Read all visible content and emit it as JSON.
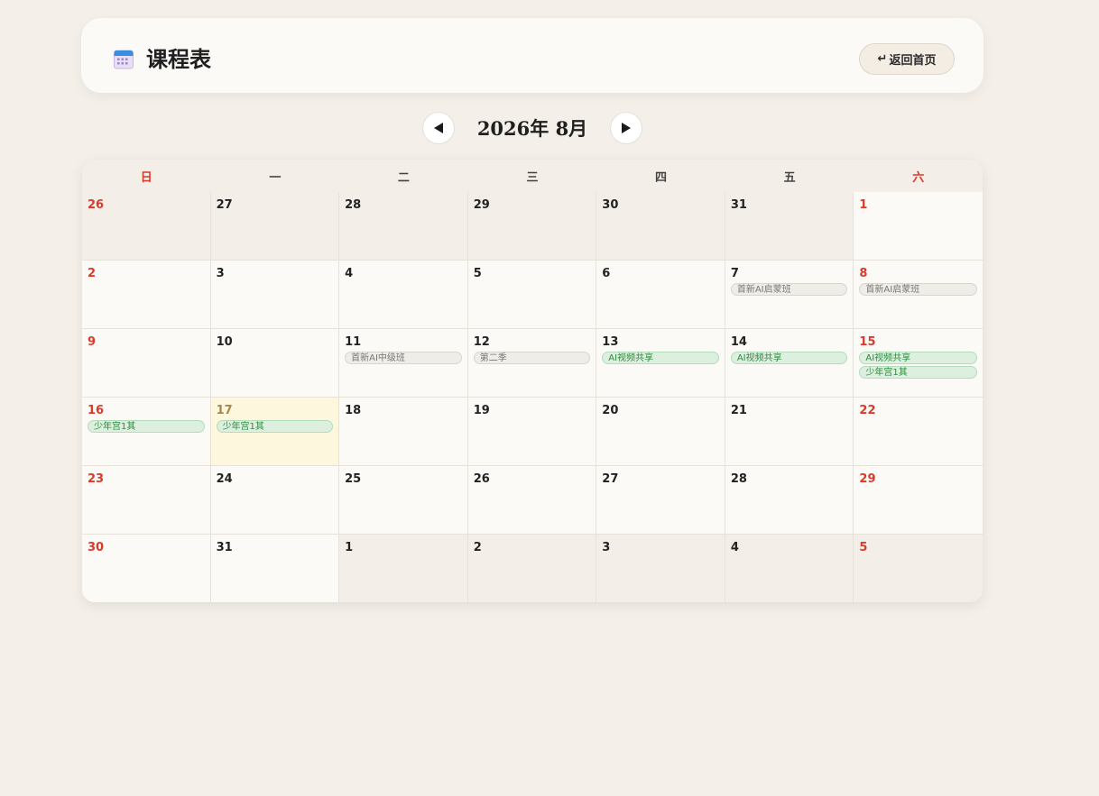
{
  "header": {
    "title": "课程表",
    "home_button": "返回首页",
    "icon": "calendar-icon"
  },
  "nav": {
    "month_label": "2026年 8月",
    "prev_icon": "triangle-left-icon",
    "next_icon": "triangle-right-icon"
  },
  "weekdays": [
    "日",
    "一",
    "二",
    "三",
    "四",
    "五",
    "六"
  ],
  "colors": {
    "weekend": "#d93b2b",
    "today_bg": "#fdf8dd",
    "event_green": "#ddefdf",
    "event_grey": "#eeede8"
  },
  "days": [
    {
      "num": "26",
      "other": true,
      "events": []
    },
    {
      "num": "27",
      "other": true,
      "events": []
    },
    {
      "num": "28",
      "other": true,
      "events": []
    },
    {
      "num": "29",
      "other": true,
      "events": []
    },
    {
      "num": "30",
      "other": true,
      "events": []
    },
    {
      "num": "31",
      "other": true,
      "events": []
    },
    {
      "num": "1",
      "other": false,
      "events": []
    },
    {
      "num": "2",
      "other": false,
      "events": []
    },
    {
      "num": "3",
      "other": false,
      "events": []
    },
    {
      "num": "4",
      "other": false,
      "events": []
    },
    {
      "num": "5",
      "other": false,
      "events": []
    },
    {
      "num": "6",
      "other": false,
      "events": []
    },
    {
      "num": "7",
      "other": false,
      "events": [
        {
          "label": "首新AI启蒙班",
          "style": "grey"
        }
      ]
    },
    {
      "num": "8",
      "other": false,
      "events": [
        {
          "label": "首新AI启蒙班",
          "style": "grey"
        }
      ]
    },
    {
      "num": "9",
      "other": false,
      "events": []
    },
    {
      "num": "10",
      "other": false,
      "events": []
    },
    {
      "num": "11",
      "other": false,
      "events": [
        {
          "label": "首新AI中级班",
          "style": "grey"
        }
      ]
    },
    {
      "num": "12",
      "other": false,
      "events": [
        {
          "label": "第二季",
          "style": "grey"
        }
      ]
    },
    {
      "num": "13",
      "other": false,
      "events": [
        {
          "label": "AI视频共享",
          "style": "green"
        }
      ]
    },
    {
      "num": "14",
      "other": false,
      "events": [
        {
          "label": "AI视频共享",
          "style": "green"
        }
      ]
    },
    {
      "num": "15",
      "other": false,
      "events": [
        {
          "label": "AI视频共享",
          "style": "green"
        },
        {
          "label": "少年宫1其",
          "style": "green"
        }
      ]
    },
    {
      "num": "16",
      "other": false,
      "events": [
        {
          "label": "少年宫1其",
          "style": "green"
        }
      ]
    },
    {
      "num": "17",
      "other": false,
      "today": true,
      "events": [
        {
          "label": "少年宫1其",
          "style": "green"
        }
      ]
    },
    {
      "num": "18",
      "other": false,
      "events": []
    },
    {
      "num": "19",
      "other": false,
      "events": []
    },
    {
      "num": "20",
      "other": false,
      "events": []
    },
    {
      "num": "21",
      "other": false,
      "events": []
    },
    {
      "num": "22",
      "other": false,
      "events": []
    },
    {
      "num": "23",
      "other": false,
      "events": []
    },
    {
      "num": "24",
      "other": false,
      "events": []
    },
    {
      "num": "25",
      "other": false,
      "events": []
    },
    {
      "num": "26",
      "other": false,
      "events": []
    },
    {
      "num": "27",
      "other": false,
      "events": []
    },
    {
      "num": "28",
      "other": false,
      "events": []
    },
    {
      "num": "29",
      "other": false,
      "events": []
    },
    {
      "num": "30",
      "other": false,
      "events": []
    },
    {
      "num": "31",
      "other": false,
      "events": []
    },
    {
      "num": "1",
      "other": true,
      "events": []
    },
    {
      "num": "2",
      "other": true,
      "events": []
    },
    {
      "num": "3",
      "other": true,
      "events": []
    },
    {
      "num": "4",
      "other": true,
      "events": []
    },
    {
      "num": "5",
      "other": true,
      "events": []
    }
  ]
}
